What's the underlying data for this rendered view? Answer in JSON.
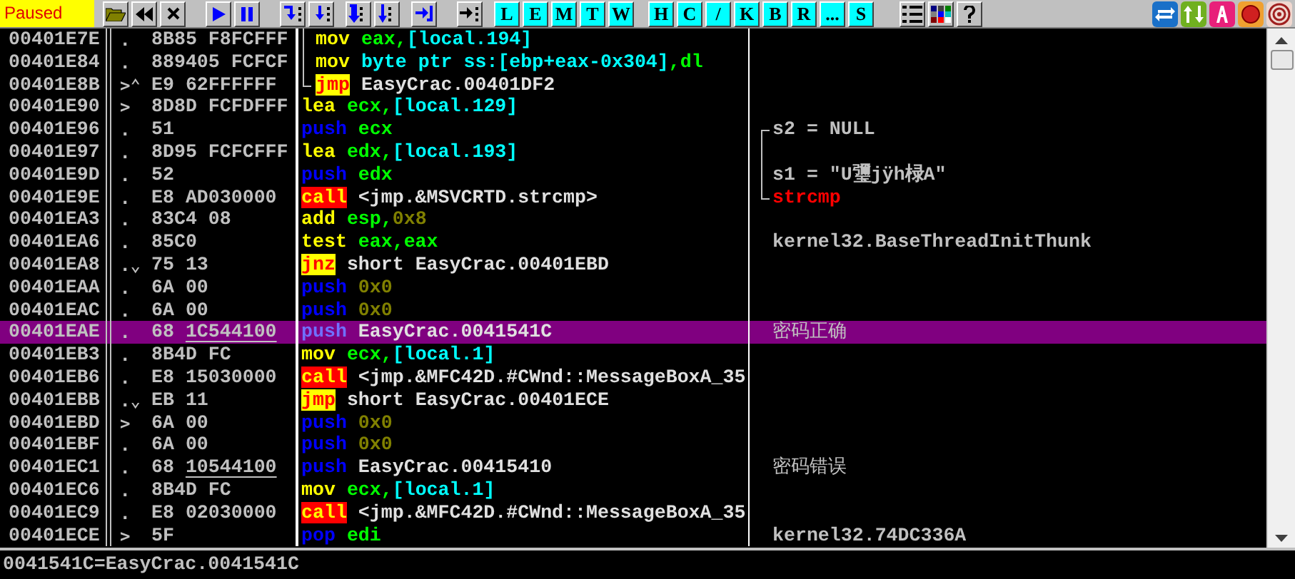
{
  "status": {
    "text": "Paused"
  },
  "letter_buttons": [
    "L",
    "E",
    "M",
    "T",
    "W",
    "H",
    "C",
    "/",
    "K",
    "B",
    "R",
    "...",
    "S"
  ],
  "rows": [
    {
      "address": "00401E7E",
      "mark": ".",
      "hex": [
        {
          "text": "8B85 F8FCFFF",
          "underlined": false
        }
      ],
      "loop_bracket": {
        "kind": "mid"
      },
      "mnemonic": {
        "text": "mov",
        "kind": "data"
      },
      "operands": [
        {
          "text": "eax,",
          "kind": "reg"
        },
        {
          "text": "[local.194]",
          "kind": "mem"
        }
      ],
      "selected": false
    },
    {
      "address": "00401E84",
      "mark": ".",
      "hex": [
        {
          "text": "889405 FCFCF",
          "underlined": false
        }
      ],
      "loop_bracket": {
        "kind": "mid"
      },
      "mnemonic": {
        "text": "mov",
        "kind": "data"
      },
      "operands": [
        {
          "text": "byte ptr ss:[ebp+eax-0x304]",
          "kind": "mem"
        },
        {
          "text": ",dl",
          "kind": "reg"
        }
      ],
      "selected": false
    },
    {
      "address": "00401E8B",
      "mark": ">⌃",
      "hex": [
        {
          "text": "E9 62FFFFFF",
          "underlined": false
        }
      ],
      "loop_bracket": {
        "kind": "end"
      },
      "mnemonic": {
        "text": "jmp",
        "kind": "jump"
      },
      "operands": [
        {
          "text": "EasyCrac.00401DF2",
          "kind": "sym"
        }
      ],
      "selected": false
    },
    {
      "address": "00401E90",
      "mark": ">",
      "hex": [
        {
          "text": "8D8D FCFDFFF",
          "underlined": false
        }
      ],
      "mnemonic": {
        "text": "lea",
        "kind": "data"
      },
      "operands": [
        {
          "text": "ecx,",
          "kind": "reg"
        },
        {
          "text": "[local.129]",
          "kind": "mem"
        }
      ],
      "selected": false
    },
    {
      "address": "00401E96",
      "mark": ".",
      "hex": [
        {
          "text": "51",
          "underlined": false
        }
      ],
      "mnemonic": {
        "text": "push",
        "kind": "stack"
      },
      "operands": [
        {
          "text": "ecx",
          "kind": "reg"
        }
      ],
      "comment": {
        "text": "s2 = NULL",
        "kind": "arg",
        "arg_bracket": {
          "kind": "top"
        }
      },
      "selected": false
    },
    {
      "address": "00401E97",
      "mark": ".",
      "hex": [
        {
          "text": "8D95 FCFCFFF",
          "underlined": false
        }
      ],
      "mnemonic": {
        "text": "lea",
        "kind": "data"
      },
      "operands": [
        {
          "text": "edx,",
          "kind": "reg"
        },
        {
          "text": "[local.193]",
          "kind": "mem"
        }
      ],
      "comment": {
        "arg_bracket": {
          "kind": "mid"
        }
      },
      "selected": false
    },
    {
      "address": "00401E9D",
      "mark": ".",
      "hex": [
        {
          "text": "52",
          "underlined": false
        }
      ],
      "mnemonic": {
        "text": "push",
        "kind": "stack"
      },
      "operands": [
        {
          "text": "edx",
          "kind": "reg"
        }
      ],
      "comment": {
        "text": "s1 = \"U瓕jÿh椂A\"",
        "kind": "arg",
        "arg_bracket": {
          "kind": "mid"
        }
      },
      "selected": false
    },
    {
      "address": "00401E9E",
      "mark": ".",
      "hex": [
        {
          "text": "E8 AD030000",
          "underlined": false
        }
      ],
      "mnemonic": {
        "text": "call",
        "kind": "call"
      },
      "operands": [
        {
          "text": "<jmp.&MSVCRTD.strcmp>",
          "kind": "sym"
        }
      ],
      "comment": {
        "text": "strcmp",
        "kind": "api",
        "arg_bracket": {
          "kind": "end"
        }
      },
      "selected": false
    },
    {
      "address": "00401EA3",
      "mark": ".",
      "hex": [
        {
          "text": "83C4 08",
          "underlined": false
        }
      ],
      "mnemonic": {
        "text": "add",
        "kind": "data"
      },
      "operands": [
        {
          "text": "esp,",
          "kind": "reg"
        },
        {
          "text": "0x8",
          "kind": "imm"
        }
      ],
      "selected": false
    },
    {
      "address": "00401EA6",
      "mark": ".",
      "hex": [
        {
          "text": "85C0",
          "underlined": false
        }
      ],
      "mnemonic": {
        "text": "test",
        "kind": "data"
      },
      "operands": [
        {
          "text": "eax,eax",
          "kind": "reg"
        }
      ],
      "comment": {
        "text": "kernel32.BaseThreadInitThunk",
        "kind": "plain"
      },
      "selected": false
    },
    {
      "address": "00401EA8",
      "mark": ".⌄",
      "hex": [
        {
          "text": "75 13",
          "underlined": false
        }
      ],
      "mnemonic": {
        "text": "jnz",
        "kind": "jump"
      },
      "operands": [
        {
          "text": "short EasyCrac.00401EBD",
          "kind": "sym"
        }
      ],
      "selected": false
    },
    {
      "address": "00401EAA",
      "mark": ".",
      "hex": [
        {
          "text": "6A 00",
          "underlined": false
        }
      ],
      "mnemonic": {
        "text": "push",
        "kind": "stack"
      },
      "operands": [
        {
          "text": "0x0",
          "kind": "imm"
        }
      ],
      "selected": false
    },
    {
      "address": "00401EAC",
      "mark": ".",
      "hex": [
        {
          "text": "6A 00",
          "underlined": false
        }
      ],
      "mnemonic": {
        "text": "push",
        "kind": "stack"
      },
      "operands": [
        {
          "text": "0x0",
          "kind": "imm"
        }
      ],
      "selected": false
    },
    {
      "address": "00401EAE",
      "mark": ".",
      "hex": [
        {
          "text": "68",
          "underlined": false
        },
        {
          "text": "1C544100",
          "underlined": true
        }
      ],
      "mnemonic": {
        "text": "push",
        "kind": "stack"
      },
      "operands": [
        {
          "text": "EasyCrac.0041541C",
          "kind": "sym"
        }
      ],
      "comment": {
        "text": "密码正确",
        "kind": "plain"
      },
      "selected": true
    },
    {
      "address": "00401EB3",
      "mark": ".",
      "hex": [
        {
          "text": "8B4D FC",
          "underlined": false
        }
      ],
      "mnemonic": {
        "text": "mov",
        "kind": "data"
      },
      "operands": [
        {
          "text": "ecx,",
          "kind": "reg"
        },
        {
          "text": "[local.1]",
          "kind": "mem"
        }
      ],
      "selected": false
    },
    {
      "address": "00401EB6",
      "mark": ".",
      "hex": [
        {
          "text": "E8 15030000",
          "underlined": false
        }
      ],
      "mnemonic": {
        "text": "call",
        "kind": "call"
      },
      "operands": [
        {
          "text": "<jmp.&MFC42D.#CWnd::MessageBoxA_35",
          "kind": "sym"
        }
      ],
      "selected": false
    },
    {
      "address": "00401EBB",
      "mark": ".⌄",
      "hex": [
        {
          "text": "EB 11",
          "underlined": false
        }
      ],
      "mnemonic": {
        "text": "jmp",
        "kind": "jump"
      },
      "operands": [
        {
          "text": "short EasyCrac.00401ECE",
          "kind": "sym"
        }
      ],
      "selected": false
    },
    {
      "address": "00401EBD",
      "mark": ">",
      "hex": [
        {
          "text": "6A 00",
          "underlined": false
        }
      ],
      "mnemonic": {
        "text": "push",
        "kind": "stack"
      },
      "operands": [
        {
          "text": "0x0",
          "kind": "imm"
        }
      ],
      "selected": false
    },
    {
      "address": "00401EBF",
      "mark": ".",
      "hex": [
        {
          "text": "6A 00",
          "underlined": false
        }
      ],
      "mnemonic": {
        "text": "push",
        "kind": "stack"
      },
      "operands": [
        {
          "text": "0x0",
          "kind": "imm"
        }
      ],
      "selected": false
    },
    {
      "address": "00401EC1",
      "mark": ".",
      "hex": [
        {
          "text": "68",
          "underlined": false
        },
        {
          "text": "10544100",
          "underlined": true
        }
      ],
      "mnemonic": {
        "text": "push",
        "kind": "stack"
      },
      "operands": [
        {
          "text": "EasyCrac.00415410",
          "kind": "sym"
        }
      ],
      "comment": {
        "text": "密码错误",
        "kind": "plain"
      },
      "selected": false
    },
    {
      "address": "00401EC6",
      "mark": ".",
      "hex": [
        {
          "text": "8B4D FC",
          "underlined": false
        }
      ],
      "mnemonic": {
        "text": "mov",
        "kind": "data"
      },
      "operands": [
        {
          "text": "ecx,",
          "kind": "reg"
        },
        {
          "text": "[local.1]",
          "kind": "mem"
        }
      ],
      "selected": false
    },
    {
      "address": "00401EC9",
      "mark": ".",
      "hex": [
        {
          "text": "E8 02030000",
          "underlined": false
        }
      ],
      "mnemonic": {
        "text": "call",
        "kind": "call"
      },
      "operands": [
        {
          "text": "<jmp.&MFC42D.#CWnd::MessageBoxA_35",
          "kind": "sym"
        }
      ],
      "selected": false
    },
    {
      "address": "00401ECE",
      "mark": ">",
      "hex": [
        {
          "text": "5F",
          "underlined": false
        }
      ],
      "mnemonic": {
        "text": "pop",
        "kind": "stack"
      },
      "operands": [
        {
          "text": "edi",
          "kind": "reg"
        }
      ],
      "comment": {
        "text": "kernel32.74DC336A",
        "kind": "plain"
      },
      "selected": false
    }
  ],
  "info_line": "0041541C=EasyCrac.0041541C"
}
